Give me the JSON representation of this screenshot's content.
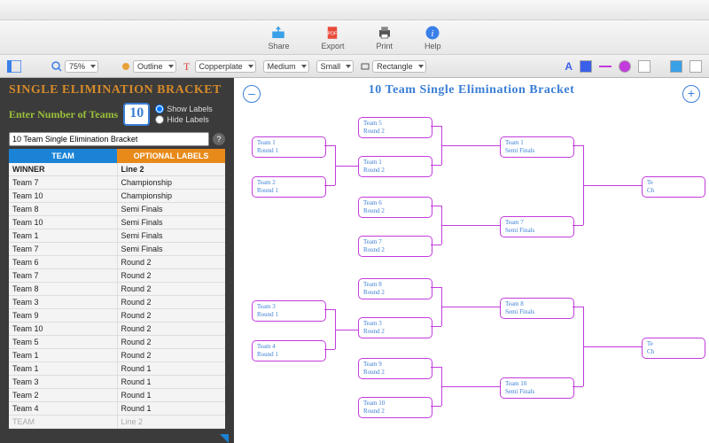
{
  "toolbar": {
    "share": "Share",
    "export": "Export",
    "print": "Print",
    "help": "Help"
  },
  "opts": {
    "zoom": "75%",
    "style": "Outline",
    "font": "Copperplate",
    "weight": "Medium",
    "size": "Small",
    "shape": "Rectangle"
  },
  "sidebar": {
    "heading": "SINGLE ELIMINATION BRACKET",
    "enter_label": "Enter Number of Teams",
    "team_count": "10",
    "show_labels": "Show Labels",
    "hide_labels": "Hide Labels",
    "title_value": "10 Team Single Elimination Bracket",
    "col_team": "TEAM",
    "col_labels": "OPTIONAL LABELS",
    "rows": [
      {
        "t": "WINNER",
        "l": "Line 2",
        "cls": "winner"
      },
      {
        "t": "Team 7",
        "l": "Championship"
      },
      {
        "t": "Team 10",
        "l": "Championship"
      },
      {
        "t": "Team 8",
        "l": "Semi Finals"
      },
      {
        "t": "Team 10",
        "l": "Semi Finals"
      },
      {
        "t": "Team 1",
        "l": "Semi Finals"
      },
      {
        "t": "Team 7",
        "l": "Semi Finals"
      },
      {
        "t": "Team 6",
        "l": "Round 2"
      },
      {
        "t": "Team 7",
        "l": "Round 2"
      },
      {
        "t": "Team 8",
        "l": "Round 2"
      },
      {
        "t": "Team 3",
        "l": "Round 2"
      },
      {
        "t": "Team 9",
        "l": "Round 2"
      },
      {
        "t": "Team 10",
        "l": "Round 2"
      },
      {
        "t": "Team 5",
        "l": "Round 2"
      },
      {
        "t": "Team 1",
        "l": "Round 2"
      },
      {
        "t": "Team 1",
        "l": "Round 1"
      },
      {
        "t": "Team 3",
        "l": "Round 1"
      },
      {
        "t": "Team 2",
        "l": "Round 1"
      },
      {
        "t": "Team 4",
        "l": "Round 1"
      },
      {
        "t": "TEAM",
        "l": "Line 2",
        "cls": "ghost"
      }
    ]
  },
  "canvas": {
    "title": "10 Team Single Elimination Bracket",
    "minus": "–",
    "plus": "+",
    "boxes": {
      "r1a": {
        "t": "Team 1",
        "s": "Round 1"
      },
      "r1b": {
        "t": "Team 2",
        "s": "Round 1"
      },
      "r1c": {
        "t": "Team 3",
        "s": "Round 1"
      },
      "r1d": {
        "t": "Team 4",
        "s": "Round 1"
      },
      "r2a": {
        "t": "Team 5",
        "s": "Round 2"
      },
      "r2b": {
        "t": "Team 1",
        "s": "Round 2"
      },
      "r2c": {
        "t": "Team 6",
        "s": "Round 2"
      },
      "r2d": {
        "t": "Team 7",
        "s": "Round 2"
      },
      "r2e": {
        "t": "Team 8",
        "s": "Round 2"
      },
      "r2f": {
        "t": "Team 3",
        "s": "Round 2"
      },
      "r2g": {
        "t": "Team 9",
        "s": "Round 2"
      },
      "r2h": {
        "t": "Team 10",
        "s": "Round 2"
      },
      "sfa": {
        "t": "Team 1",
        "s": "Semi Finals"
      },
      "sfb": {
        "t": "Team 7",
        "s": "Semi Finals"
      },
      "sfc": {
        "t": "Team 8",
        "s": "Semi Finals"
      },
      "sfd": {
        "t": "Team 10",
        "s": "Semi Finals"
      },
      "cha": {
        "t": "Te",
        "s": "Ch"
      },
      "chb": {
        "t": "Te",
        "s": "Ch"
      }
    }
  }
}
